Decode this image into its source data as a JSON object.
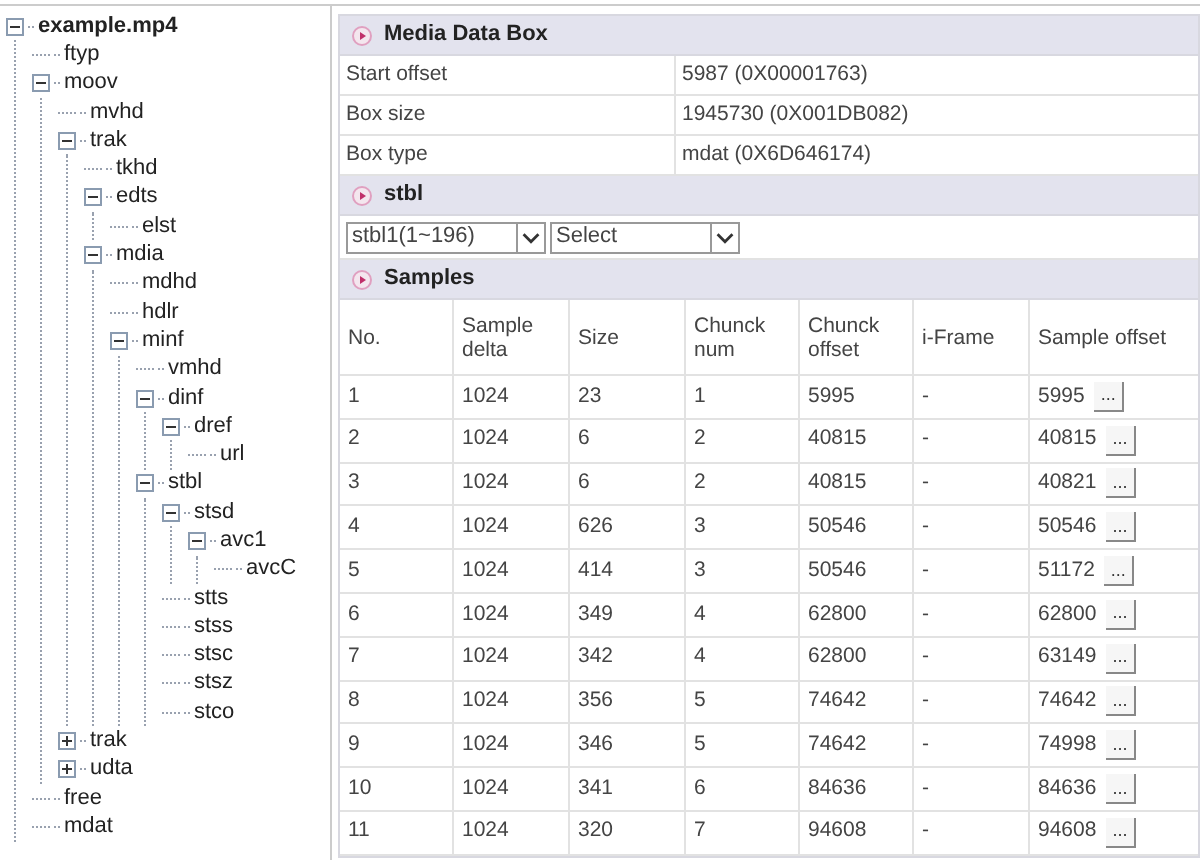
{
  "tree": {
    "label": "example.mp4",
    "expanded": true,
    "children": [
      {
        "label": "ftyp"
      },
      {
        "label": "moov",
        "expanded": true,
        "children": [
          {
            "label": "mvhd"
          },
          {
            "label": "trak",
            "expanded": true,
            "children": [
              {
                "label": "tkhd"
              },
              {
                "label": "edts",
                "expanded": true,
                "children": [
                  {
                    "label": "elst"
                  }
                ]
              },
              {
                "label": "mdia",
                "expanded": true,
                "children": [
                  {
                    "label": "mdhd"
                  },
                  {
                    "label": "hdlr"
                  },
                  {
                    "label": "minf",
                    "expanded": true,
                    "children": [
                      {
                        "label": "vmhd"
                      },
                      {
                        "label": "dinf",
                        "expanded": true,
                        "children": [
                          {
                            "label": "dref",
                            "expanded": true,
                            "children": [
                              {
                                "label": "url"
                              }
                            ]
                          }
                        ]
                      },
                      {
                        "label": "stbl",
                        "expanded": true,
                        "children": [
                          {
                            "label": "stsd",
                            "expanded": true,
                            "children": [
                              {
                                "label": "avc1",
                                "expanded": true,
                                "children": [
                                  {
                                    "label": "avcC"
                                  }
                                ]
                              }
                            ]
                          },
                          {
                            "label": "stts"
                          },
                          {
                            "label": "stss"
                          },
                          {
                            "label": "stsc"
                          },
                          {
                            "label": "stsz"
                          },
                          {
                            "label": "stco"
                          }
                        ]
                      }
                    ]
                  }
                ]
              }
            ]
          },
          {
            "label": "trak",
            "expanded": false
          },
          {
            "label": "udta",
            "expanded": false
          }
        ]
      },
      {
        "label": "free"
      },
      {
        "label": "mdat"
      }
    ]
  },
  "media_box": {
    "title": "Media Data Box",
    "rows": [
      {
        "label": "Start offset",
        "value": "5987 (0X00001763)"
      },
      {
        "label": "Box size",
        "value": "1945730 (0X001DB082)"
      },
      {
        "label": "Box type",
        "value": "mdat (0X6D646174)"
      }
    ]
  },
  "stbl": {
    "title": "stbl",
    "selects": [
      "stbl1(1~196)",
      "Select"
    ]
  },
  "samples": {
    "title": "Samples",
    "columns": [
      "No.",
      "Sample delta",
      "Size",
      "Chunck num",
      "Chunck offset",
      "i-Frame",
      "Sample offset"
    ],
    "button": "...",
    "rows": [
      [
        "1",
        "1024",
        "23",
        "1",
        "5995",
        "-",
        "5995"
      ],
      [
        "2",
        "1024",
        "6",
        "2",
        "40815",
        "-",
        "40815"
      ],
      [
        "3",
        "1024",
        "6",
        "2",
        "40815",
        "-",
        "40821"
      ],
      [
        "4",
        "1024",
        "626",
        "3",
        "50546",
        "-",
        "50546"
      ],
      [
        "5",
        "1024",
        "414",
        "3",
        "50546",
        "-",
        "51172"
      ],
      [
        "6",
        "1024",
        "349",
        "4",
        "62800",
        "-",
        "62800"
      ],
      [
        "7",
        "1024",
        "342",
        "4",
        "62800",
        "-",
        "63149"
      ],
      [
        "8",
        "1024",
        "356",
        "5",
        "74642",
        "-",
        "74642"
      ],
      [
        "9",
        "1024",
        "346",
        "5",
        "74642",
        "-",
        "74998"
      ],
      [
        "10",
        "1024",
        "341",
        "6",
        "84636",
        "-",
        "84636"
      ],
      [
        "11",
        "1024",
        "320",
        "7",
        "94608",
        "-",
        "94608"
      ]
    ]
  }
}
